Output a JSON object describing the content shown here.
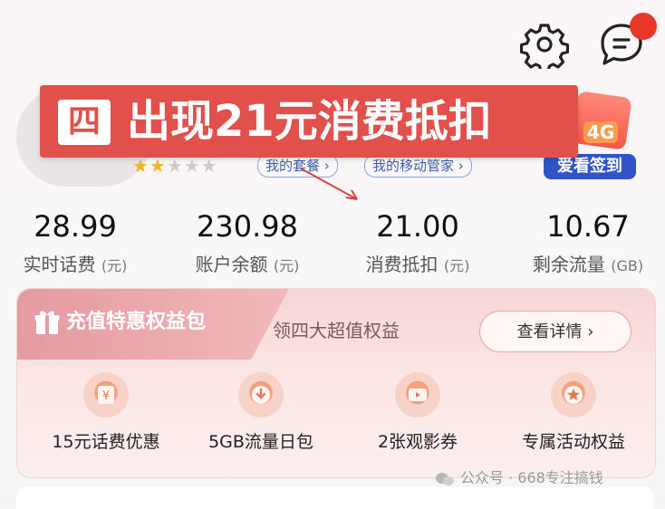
{
  "header": {
    "settings_icon": "gear-icon",
    "messages_icon": "chat-bubble-icon",
    "badge_color": "#e8362a"
  },
  "profile": {
    "stars_total": 5,
    "stars_filled": 2,
    "chip_plan": "我的套餐 ›",
    "chip_manager": "我的移动管家 ›"
  },
  "promo": {
    "badge": "4G",
    "label": "爱看签到"
  },
  "banner": {
    "tag": "四",
    "text": "出现21元消费抵扣",
    "color": "#e2504b"
  },
  "stats": [
    {
      "value": "28.99",
      "label": "实时话费",
      "unit": "(元)"
    },
    {
      "value": "230.98",
      "label": "账户余额",
      "unit": "(元)"
    },
    {
      "value": "21.00",
      "label": "消费抵扣",
      "unit": "(元)"
    },
    {
      "value": "10.67",
      "label": "剩余流量",
      "unit": "(GB)"
    }
  ],
  "benefits_card": {
    "title": "充值特惠权益包",
    "subtitle": "领四大超值权益",
    "detail_button": "查看详情 ›",
    "items": [
      {
        "label": "15元话费优惠",
        "icon": "yuan-coin-icon"
      },
      {
        "label": "5GB流量日包",
        "icon": "data-download-icon"
      },
      {
        "label": "2张观影券",
        "icon": "movie-ticket-icon"
      },
      {
        "label": "专属活动权益",
        "icon": "star-badge-icon"
      }
    ]
  },
  "watermark": "公众号 · 668专注搞钱"
}
